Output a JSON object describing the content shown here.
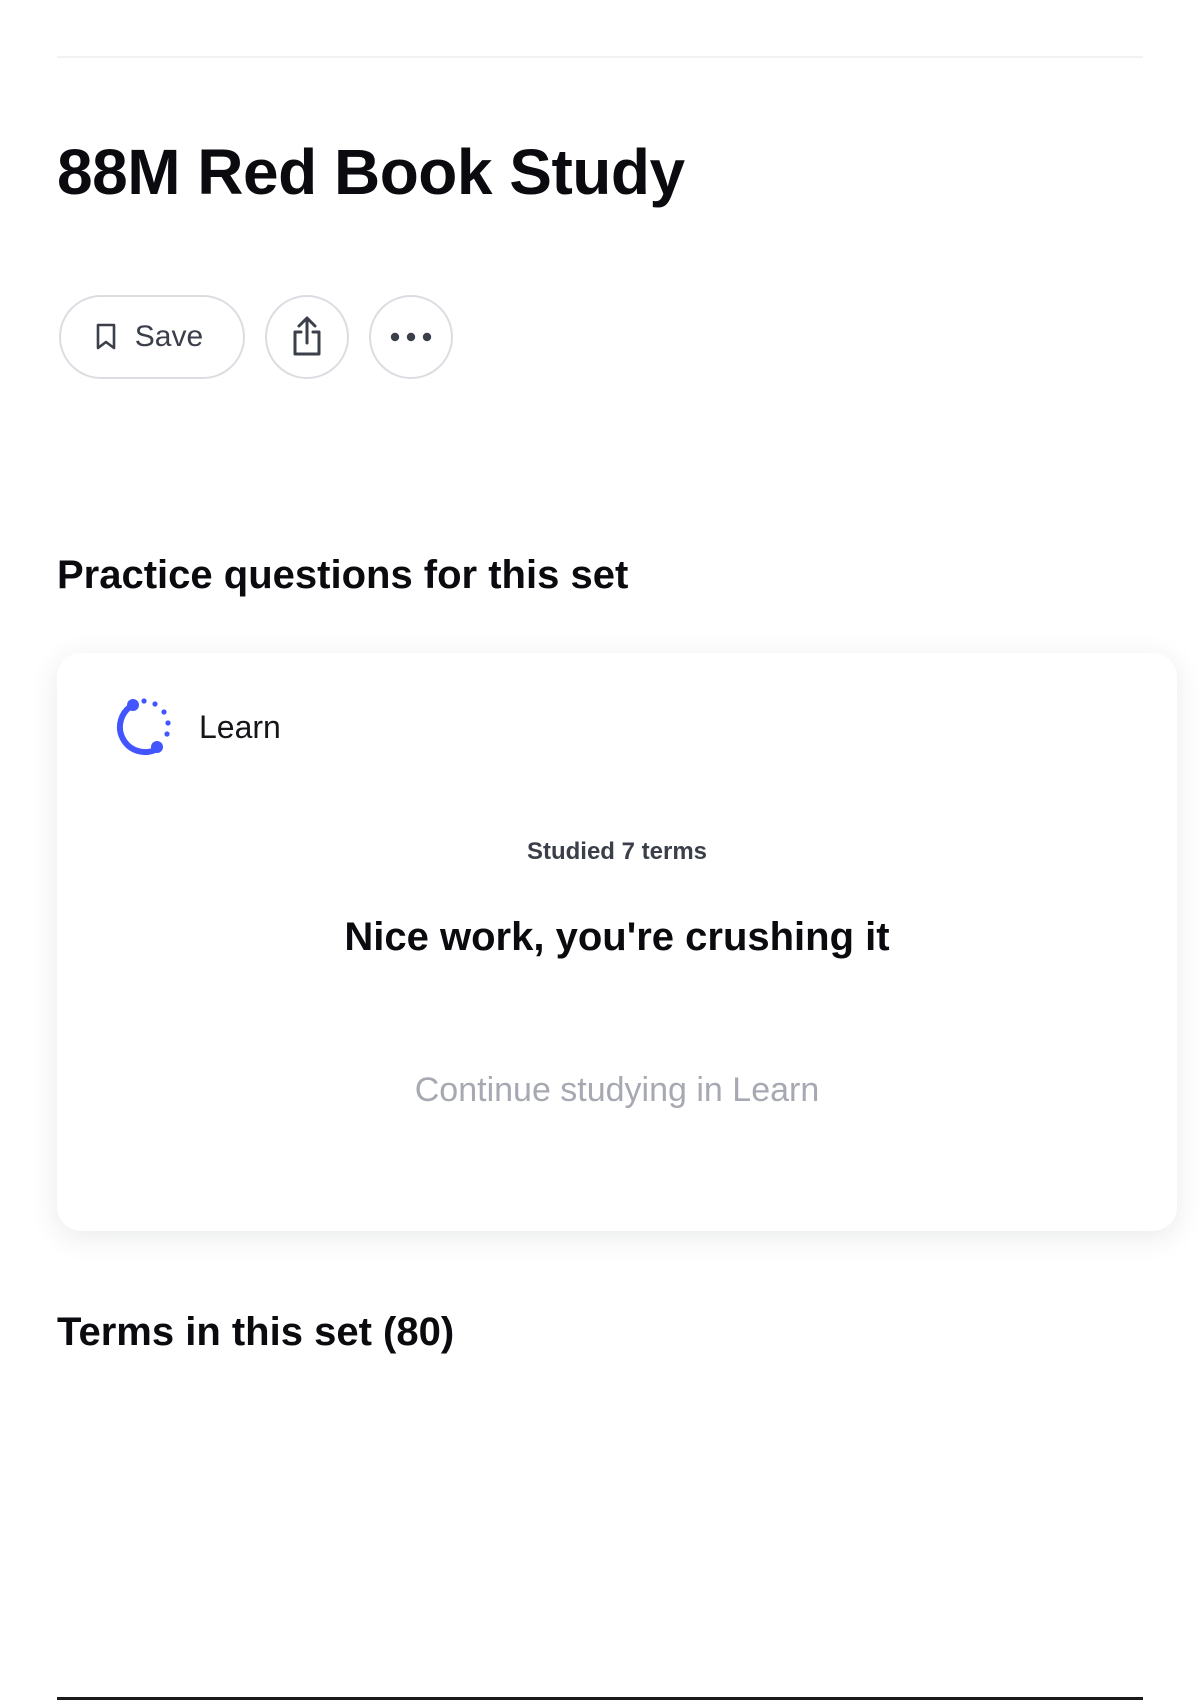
{
  "set": {
    "title": "88M Red Book Study"
  },
  "actions": {
    "save_label": "Save",
    "save_icon": "bookmark-icon",
    "share_icon": "share-icon",
    "more_icon": "more-horizontal-icon"
  },
  "practice": {
    "heading": "Practice questions for this set",
    "learn_card": {
      "mode_label": "Learn",
      "mode_icon": "learn-progress-icon",
      "studied_text": "Studied 7 terms",
      "message": "Nice work, you're crushing it",
      "continue_link": "Continue studying in Learn"
    }
  },
  "terms": {
    "heading": "Terms in this set (80)"
  },
  "colors": {
    "accent": "#4255ff",
    "text_primary": "#0b0b0f",
    "text_secondary": "#3b3f4a",
    "text_muted": "#a6a9b1",
    "border": "#dcdde3"
  }
}
